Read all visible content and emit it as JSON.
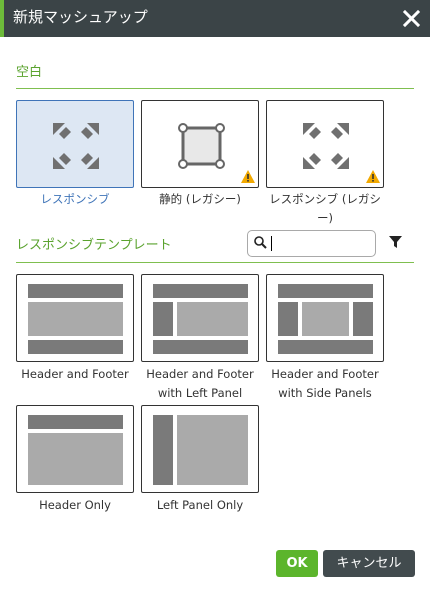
{
  "dialog": {
    "title": "新規マッシュアップ"
  },
  "sections": {
    "blank": "空白",
    "responsive_templates": "レスポンシブテンプレート"
  },
  "blank_tiles": [
    {
      "label": "レスポンシブ",
      "selected": true
    },
    {
      "label": "静的 (レガシー)",
      "warning": true
    },
    {
      "label_line1": "レスポンシブ (レガシ",
      "label_line2": "ー)",
      "warning": true
    }
  ],
  "templates": [
    {
      "label": "Header and Footer"
    },
    {
      "label_line1": "Header and Footer",
      "label_line2": "with Left Panel"
    },
    {
      "label_line1": "Header and Footer",
      "label_line2": "with Side Panels"
    },
    {
      "label": "Header Only"
    },
    {
      "label": "Left Panel Only"
    }
  ],
  "search": {
    "value": ""
  },
  "buttons": {
    "ok": "OK",
    "cancel": "キャンセル"
  },
  "colors": {
    "titlebar": "#3b4447",
    "accent_green": "#5ba32f",
    "selected_blue": "#3f74b8",
    "ok_green": "#5cb52c",
    "warning_yellow": "#f2a900"
  }
}
